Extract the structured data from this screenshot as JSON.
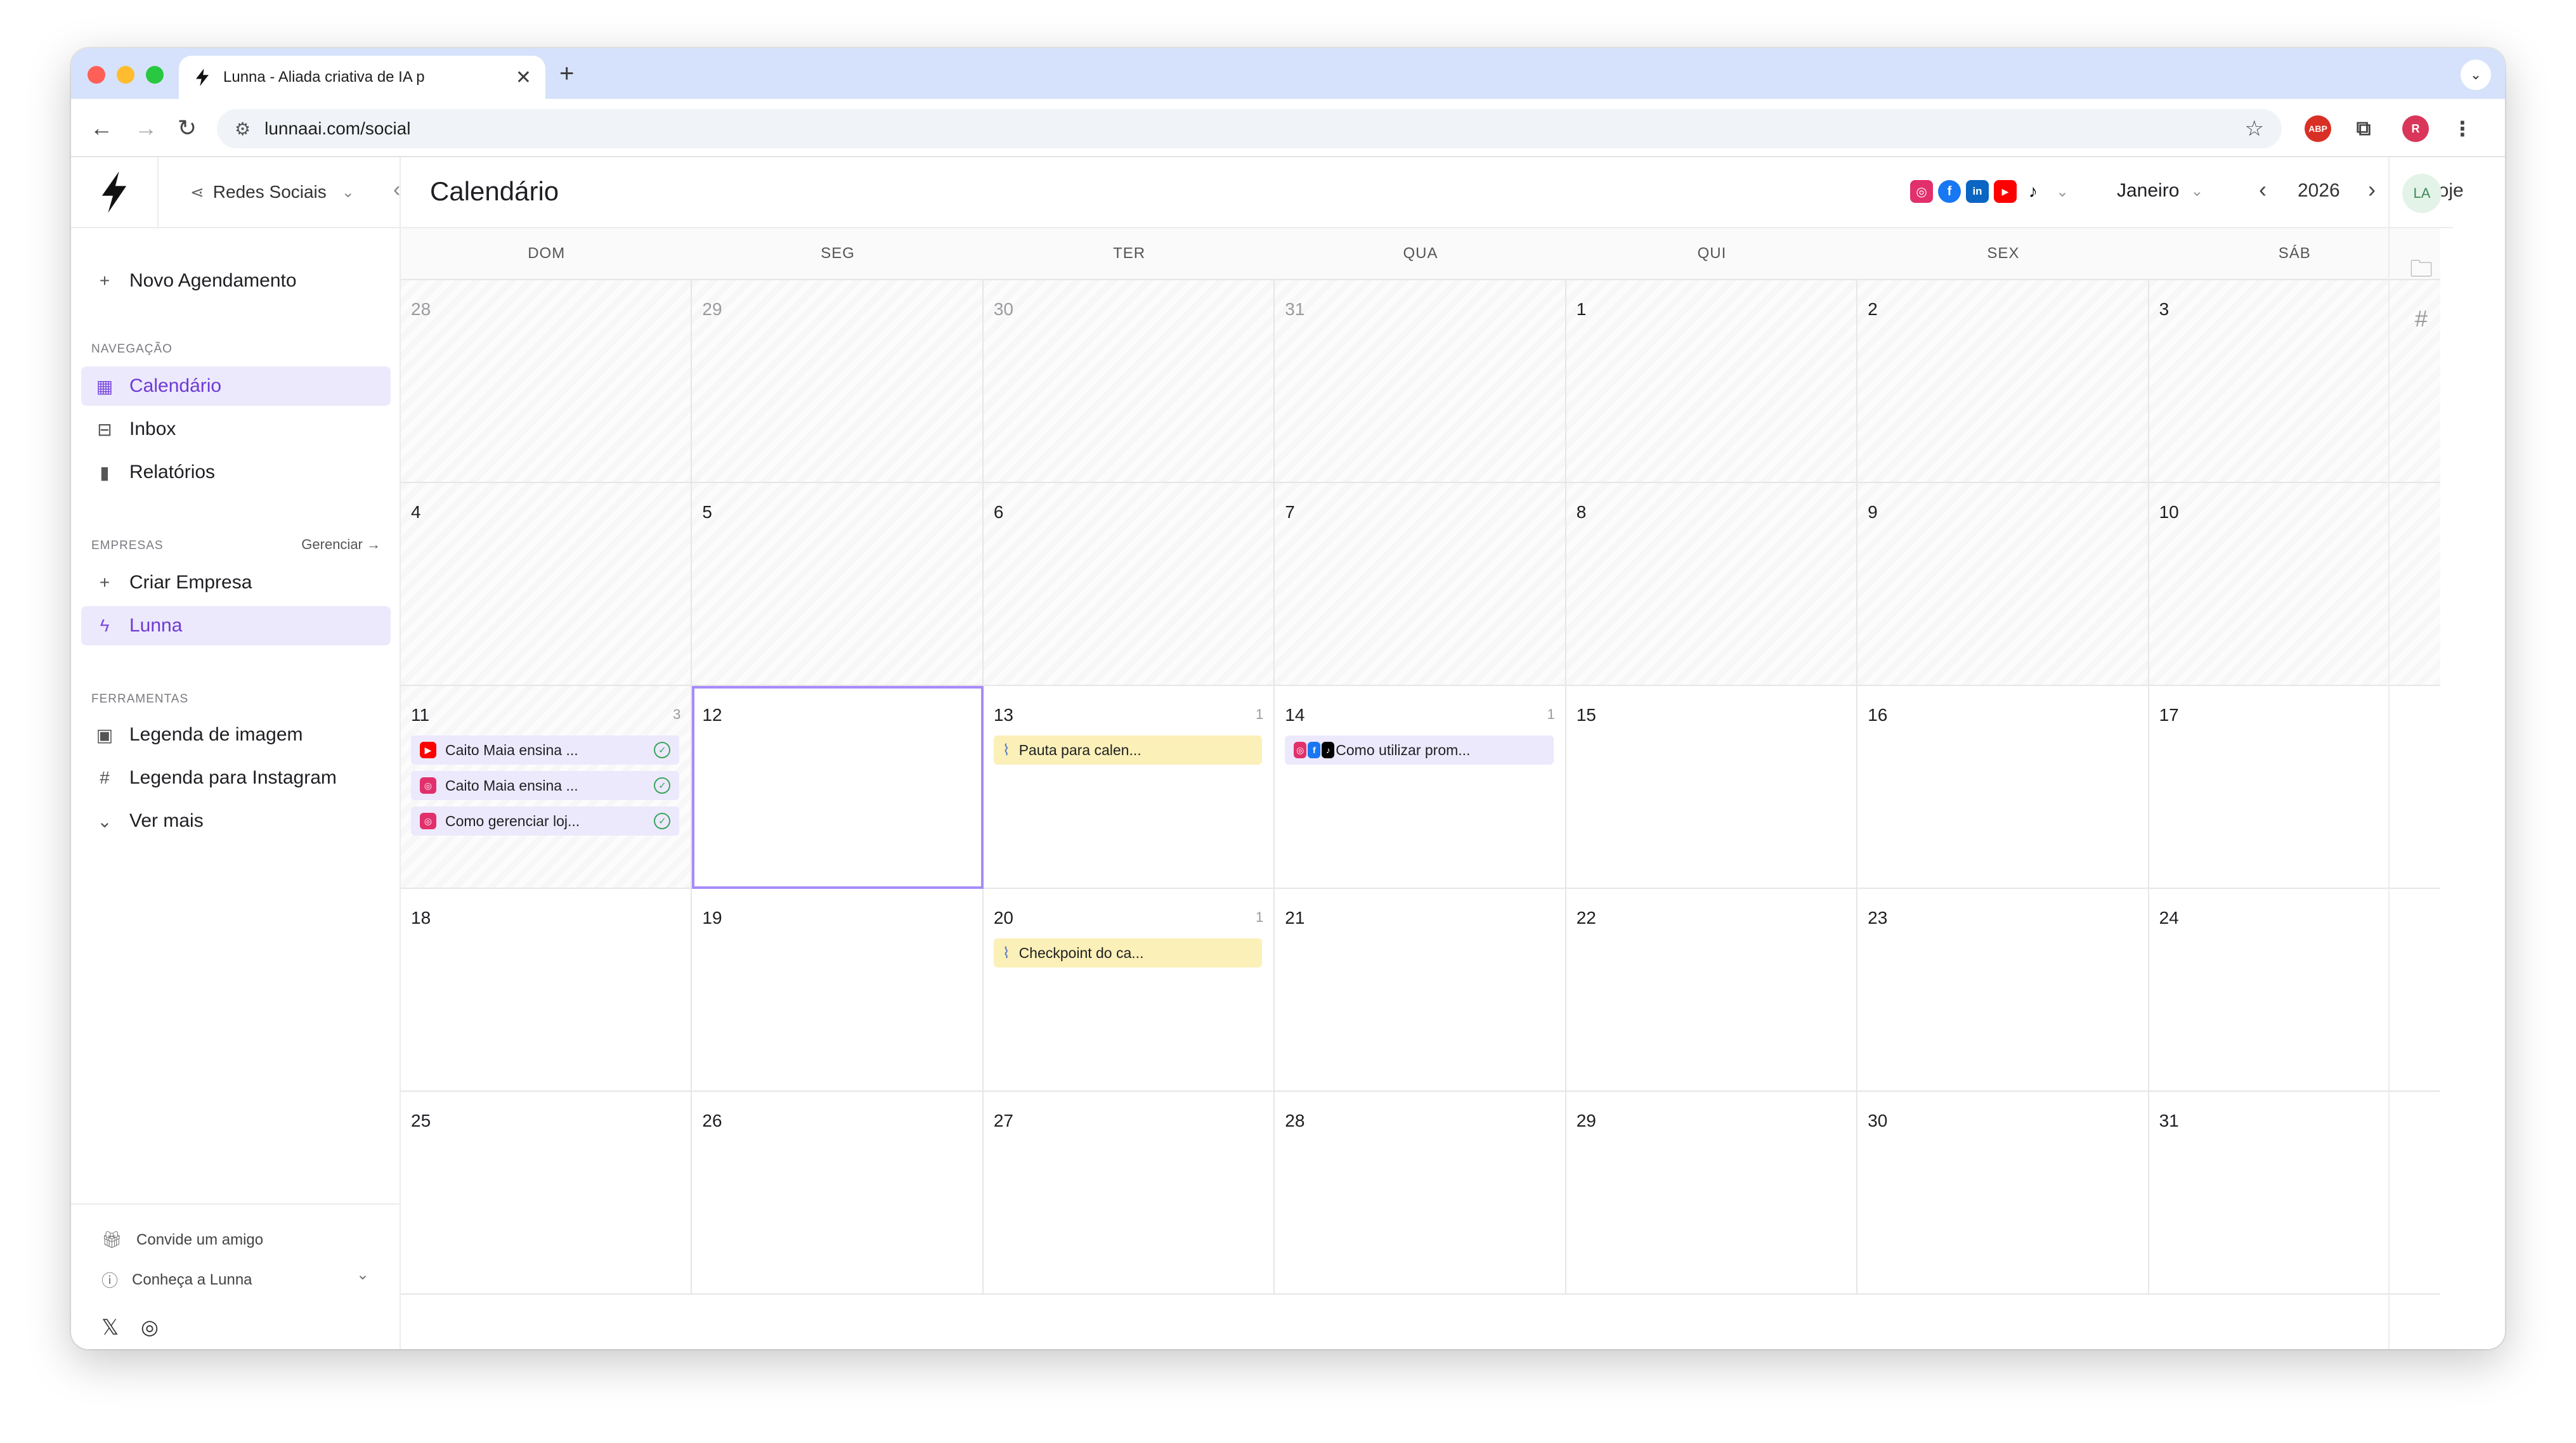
{
  "browser": {
    "tab_title": "Lunna - Aliada criativa de IA p",
    "url": "lunnaai.com/social",
    "profile_initial": "R",
    "abp_label": "ABP"
  },
  "sidebar": {
    "workspace": "Redes Sociais",
    "new_schedule": "Novo Agendamento",
    "nav_label": "NAVEGAÇÃO",
    "nav_items": [
      {
        "label": "Calendário",
        "icon": "calendar-icon",
        "active": true
      },
      {
        "label": "Inbox",
        "icon": "inbox-icon",
        "active": false
      },
      {
        "label": "Relatórios",
        "icon": "bar-chart-icon",
        "active": false
      }
    ],
    "companies_label": "EMPRESAS",
    "manage_link": "Gerenciar",
    "create_company": "Criar Empresa",
    "company_active": "Lunna",
    "tools_label": "FERRAMENTAS",
    "tools": [
      {
        "label": "Legenda de imagem",
        "icon": "image-icon"
      },
      {
        "label": "Legenda para Instagram",
        "icon": "hash-icon"
      },
      {
        "label": "Ver mais",
        "icon": "chevron-down-icon"
      }
    ],
    "invite": "Convide um amigo",
    "discover": "Conheça a Lunna"
  },
  "header": {
    "title": "Calendário",
    "month": "Janeiro",
    "year": "2026",
    "today": "Hoje",
    "user_initials": "LA"
  },
  "colors": {
    "accent": "#7c4ddf",
    "instagram": "#e1306c",
    "facebook": "#1877f2",
    "linkedin": "#0a66c2",
    "youtube": "#ff0000",
    "tiktok": "#000000"
  },
  "calendar": {
    "weekdays": [
      "DOM",
      "SEG",
      "TER",
      "QUA",
      "QUI",
      "SEX",
      "SÁB"
    ],
    "days": [
      {
        "n": "28",
        "past": true,
        "outside": true
      },
      {
        "n": "29",
        "past": true,
        "outside": true
      },
      {
        "n": "30",
        "past": true,
        "outside": true
      },
      {
        "n": "31",
        "past": true,
        "outside": true
      },
      {
        "n": "1",
        "past": true
      },
      {
        "n": "2",
        "past": true
      },
      {
        "n": "3",
        "past": true
      },
      {
        "n": "4",
        "past": true
      },
      {
        "n": "5",
        "past": true
      },
      {
        "n": "6",
        "past": true
      },
      {
        "n": "7",
        "past": true
      },
      {
        "n": "8",
        "past": true
      },
      {
        "n": "9",
        "past": true
      },
      {
        "n": "10",
        "past": true
      },
      {
        "n": "11",
        "past": true,
        "count": "3",
        "events": [
          {
            "text": "Caito Maia ensina ...",
            "color": "purple",
            "icon": "youtube",
            "done": true
          },
          {
            "text": "Caito Maia ensina ...",
            "color": "purple",
            "icon": "instagram",
            "done": true
          },
          {
            "text": "Como gerenciar loj...",
            "color": "purple",
            "icon": "instagram",
            "done": true
          }
        ]
      },
      {
        "n": "12",
        "today": true
      },
      {
        "n": "13",
        "count": "1",
        "events": [
          {
            "text": "Pauta para calen...",
            "color": "yellow",
            "icon": "clip"
          }
        ]
      },
      {
        "n": "14",
        "count": "1",
        "events": [
          {
            "text": "Como utilizar prom...",
            "color": "purple",
            "icon": "multi"
          }
        ]
      },
      {
        "n": "15"
      },
      {
        "n": "16"
      },
      {
        "n": "17"
      },
      {
        "n": "18"
      },
      {
        "n": "19"
      },
      {
        "n": "20",
        "count": "1",
        "events": [
          {
            "text": "Checkpoint do ca...",
            "color": "yellow",
            "icon": "clip"
          }
        ]
      },
      {
        "n": "21"
      },
      {
        "n": "22"
      },
      {
        "n": "23"
      },
      {
        "n": "24"
      },
      {
        "n": "25"
      },
      {
        "n": "26"
      },
      {
        "n": "27"
      },
      {
        "n": "28"
      },
      {
        "n": "29"
      },
      {
        "n": "30"
      },
      {
        "n": "31"
      }
    ]
  }
}
